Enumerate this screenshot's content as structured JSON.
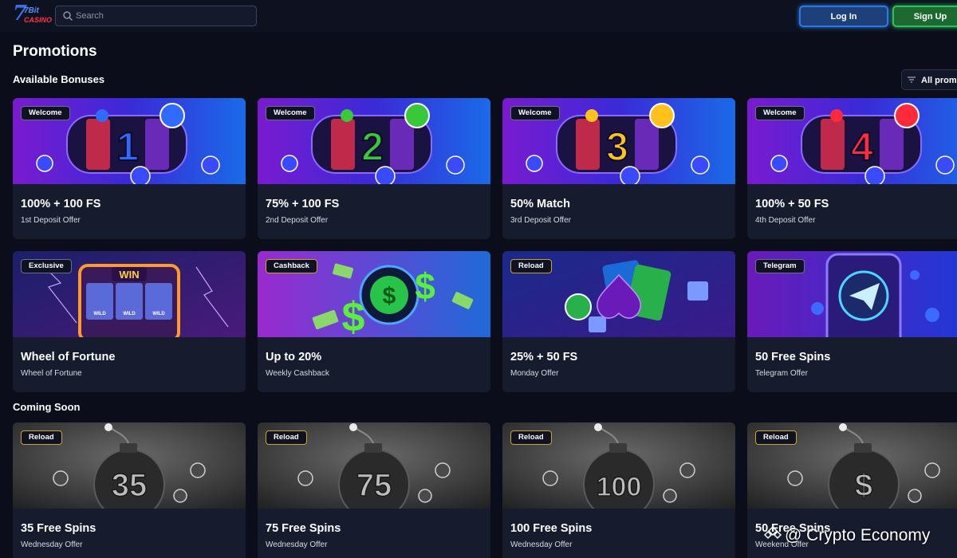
{
  "header": {
    "logo_top": "7Bit",
    "logo_bottom": "CASINO",
    "search_placeholder": "Search",
    "login_label": "Log In",
    "signup_label": "Sign Up"
  },
  "page_title": "Promotions",
  "sections": {
    "available": "Available Bonuses",
    "coming_soon": "Coming Soon"
  },
  "filter_label": "All prom",
  "available_cards": [
    {
      "tag": "Welcome",
      "title": "100% + 100 FS",
      "subtitle": "1st Deposit Offer",
      "number": "1",
      "color": "#2f6bff"
    },
    {
      "tag": "Welcome",
      "title": "75% + 100 FS",
      "subtitle": "2nd Deposit Offer",
      "number": "2",
      "color": "#38c83a"
    },
    {
      "tag": "Welcome",
      "title": "50% Match",
      "subtitle": "3rd Deposit Offer",
      "number": "3",
      "color": "#ffc21a"
    },
    {
      "tag": "Welcome",
      "title": "100% + 50 FS",
      "subtitle": "4th Deposit Offer",
      "number": "4",
      "color": "#ff2a3a"
    },
    {
      "tag": "Exclusive",
      "title": "Wheel of Fortune",
      "subtitle": "Wheel of Fortune"
    },
    {
      "tag": "Cashback",
      "title": "Up to 20%",
      "subtitle": "Weekly Cashback"
    },
    {
      "tag": "Reload",
      "title": "25% + 50 FS",
      "subtitle": "Monday Offer"
    },
    {
      "tag": "Telegram",
      "title": "50 Free Spins",
      "subtitle": "Telegram Offer"
    }
  ],
  "coming_cards": [
    {
      "tag": "Reload",
      "title": "35 Free Spins",
      "subtitle": "Wednesday Offer",
      "number": "35"
    },
    {
      "tag": "Reload",
      "title": "75 Free Spins",
      "subtitle": "Wednesday Offer",
      "number": "75"
    },
    {
      "tag": "Reload",
      "title": "100 Free Spins",
      "subtitle": "Wednesday Offer",
      "number": "100"
    },
    {
      "tag": "Reload",
      "title": "50 Free Spins",
      "subtitle": "Weekend Offer",
      "number": "$"
    }
  ],
  "banner_texts": {
    "win": "WIN",
    "wild": "WILD"
  },
  "watermark": "@ Crypto Economy",
  "icons": [
    "search-icon",
    "filter-icon",
    "paper-plane-icon",
    "dollar-icon",
    "spade-icon",
    "bomb-icon",
    "crypto-economy-icon"
  ]
}
